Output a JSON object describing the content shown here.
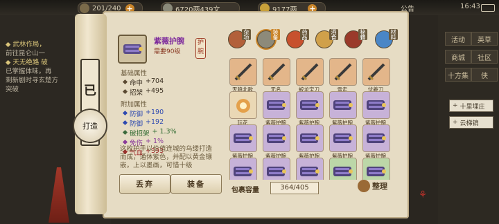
{
  "topbar": {
    "energy": "201/240",
    "money1": "6720两439文",
    "money2": "9177两",
    "announce": "公告",
    "time": "16:43"
  },
  "quests": {
    "line1": "◆ 武林作局，",
    "line2": "前往昆仑山一",
    "line3": "◆ 天无绝路 破",
    "line4": "已掌握体味，再",
    "line5": "剩新剧时寻玄楚方",
    "line6": "突破"
  },
  "scroll_label": "已",
  "craft_label": "打造",
  "item": {
    "name": "紫薇护腕",
    "require": "需要90级",
    "tag": "护腕",
    "base_title": "基础属性",
    "base_attrs": [
      {
        "k": "命中",
        "v": "+704"
      },
      {
        "k": "招架",
        "v": "+495"
      }
    ],
    "extra_title": "附加属性",
    "extra_attrs": [
      {
        "k": "防御",
        "v": "+190"
      },
      {
        "k": "防御",
        "v": "+192"
      },
      {
        "k": "破招架",
        "v": "+ 1.3%"
      },
      {
        "k": "免伤",
        "v": "+ 1%"
      },
      {
        "k": "气血",
        "v": "+393"
      }
    ],
    "desc": "这枚护手以价值连城的乌缕打造而成，通体紫色，并配以黄金镶嵌，上以墨画，可惜十级"
  },
  "buttons": {
    "discard": "丢弃",
    "equip": "装备",
    "organize": "整理"
  },
  "tabs": [
    "杂项",
    "装备",
    "药品",
    "酒食",
    "秘籍",
    "材料"
  ],
  "grid_items": [
    {
      "name": "天狼北歌",
      "kind": "sword"
    },
    {
      "name": "无名",
      "kind": "sword"
    },
    {
      "name": "蛟龙宝刀",
      "kind": "sword"
    },
    {
      "name": "雪走",
      "kind": "sword"
    },
    {
      "name": "伏羲刀",
      "kind": "sword"
    },
    {
      "name": "玩花",
      "kind": "pig"
    },
    {
      "name": "紫薇护腕",
      "kind": "wrist"
    },
    {
      "name": "紫薇护腕",
      "kind": "wrist"
    },
    {
      "name": "紫薇护腕",
      "kind": "wrist"
    },
    {
      "name": "紫薇护腕",
      "kind": "wrist"
    },
    {
      "name": "紫薇护腕",
      "kind": "wrist"
    },
    {
      "name": "紫薇护腕",
      "kind": "wrist"
    },
    {
      "name": "紫薇护腕",
      "kind": "wrist"
    },
    {
      "name": "紫薇护腕",
      "kind": "wrist"
    },
    {
      "name": "紫薇护腕",
      "kind": "wrist"
    },
    {
      "name": "",
      "kind": "wrist"
    },
    {
      "name": "",
      "kind": "wrist"
    },
    {
      "name": "",
      "kind": "wrist"
    },
    {
      "name": "",
      "kind": "wrist-green"
    },
    {
      "name": "",
      "kind": "wrist-green"
    }
  ],
  "capacity": {
    "label": "包裹容量",
    "value": "364/405"
  },
  "right": {
    "buttons": [
      "活动",
      "英草",
      "商城",
      "社区"
    ],
    "tabs": [
      "十方集",
      "侠"
    ],
    "list": [
      "十里埋庄",
      "云梯镜"
    ]
  },
  "colors": {
    "accent": "#8c3a20",
    "purple": "#7d2a9c",
    "blue": "#2f4ab0"
  }
}
